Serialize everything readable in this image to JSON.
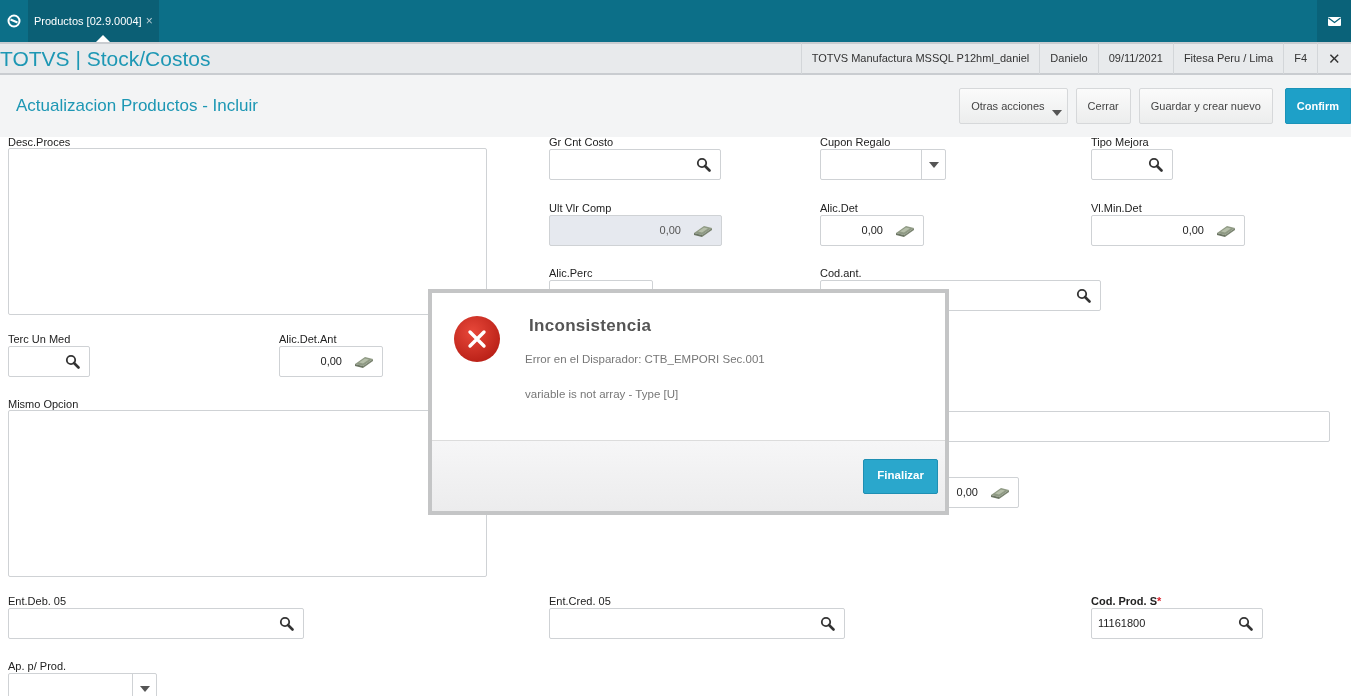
{
  "tab_bar": {
    "tabs": [
      {
        "label": "Productos [02.9.0004]",
        "close": "×",
        "selected": true
      }
    ]
  },
  "header": {
    "app_title": "TOTVS | Stock/Costos",
    "info": [
      "TOTVS Manufactura MSSQL P12hml_daniel",
      "Danielo",
      "09/11/2021",
      "Fitesa Peru / Lima",
      "F4"
    ],
    "close": "✕"
  },
  "toolbar": {
    "title": "Actualizacion Productos - Incluir",
    "buttons": [
      {
        "label": "Otras acciones",
        "kind": "dropdown"
      },
      {
        "label": "Cerrar",
        "kind": "default"
      },
      {
        "label": "Guardar y crear nuevo",
        "kind": "default"
      },
      {
        "label": "Confirm",
        "kind": "primary"
      }
    ]
  },
  "form": {
    "fields": [
      {
        "label": "Desc.Proces",
        "kind": "memo",
        "disabled": false,
        "required": false
      },
      {
        "label": "Gr Cnt Costo",
        "kind": "lookup",
        "disabled": false,
        "required": false
      },
      {
        "label": "Cupon Regalo",
        "kind": "select",
        "disabled": false,
        "required": false
      },
      {
        "label": "Tipo Mejora",
        "kind": "lookup",
        "disabled": false,
        "required": false
      },
      {
        "label": "Ult Vlr Comp",
        "kind": "money",
        "value": "0,00",
        "disabled": true,
        "required": false
      },
      {
        "label": "Alic.Det",
        "kind": "money",
        "value": "0,00",
        "disabled": false,
        "required": false
      },
      {
        "label": "Vl.Min.Det",
        "kind": "money",
        "value": "0,00",
        "disabled": false,
        "required": false
      },
      {
        "label": "Alic.Perc",
        "kind": "text",
        "disabled": false,
        "required": false
      },
      {
        "label": "Cod.ant.",
        "kind": "lookup",
        "disabled": false,
        "required": false
      },
      {
        "label": "Terc Un Med",
        "kind": "lookup",
        "disabled": false,
        "required": false
      },
      {
        "label": "Alic.Det.Ant",
        "kind": "money",
        "value": "0,00",
        "disabled": false,
        "required": false
      },
      {
        "label": "Mismo Opcion",
        "kind": "memo",
        "disabled": false,
        "required": false
      },
      {
        "kind": "text",
        "disabled": false
      },
      {
        "kind": "money",
        "value": "0,00",
        "disabled": false
      },
      {
        "label": "Ent.Deb. 05",
        "kind": "lookup",
        "disabled": false,
        "required": false
      },
      {
        "label": "Ent.Cred. 05",
        "kind": "lookup",
        "disabled": false,
        "required": false
      },
      {
        "label": "Cod. Prod. S",
        "required_mark": "*",
        "kind": "lookup",
        "value": "11161800",
        "disabled": false,
        "required": true
      },
      {
        "label": "Ap. p/ Prod.",
        "kind": "select",
        "disabled": false,
        "required": false
      }
    ]
  },
  "dialog": {
    "title": "Inconsistencia",
    "messages": [
      "Error en el Disparador: CTB_EMPORI Sec.001",
      "variable is not array - Type [U]"
    ],
    "buttons": [
      {
        "label": "Finalizar",
        "kind": "primary"
      }
    ]
  }
}
